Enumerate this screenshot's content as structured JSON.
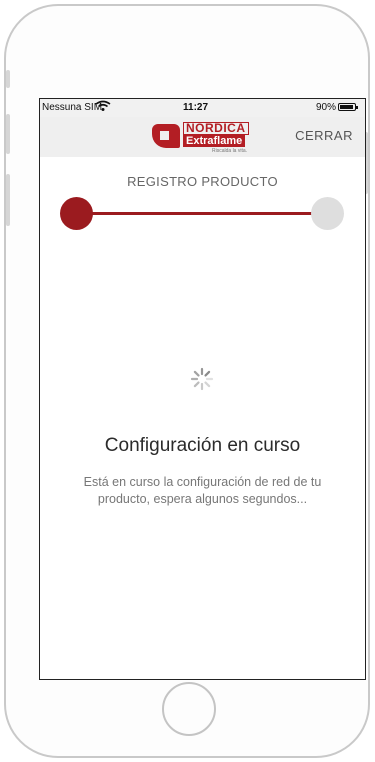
{
  "status_bar": {
    "carrier": "Nessuna SIM",
    "time": "11:27",
    "battery": "90%",
    "battery_level": 0.9
  },
  "header": {
    "logo": {
      "brand_line1": "NORDICA",
      "brand_line2": "Extraflame",
      "tagline": "Riscalda la vita."
    },
    "close_label": "CERRAR"
  },
  "registration": {
    "step_title": "REGISTRO PRODUCTO",
    "progress": 1.0
  },
  "status": {
    "headline": "Configuración en curso",
    "message": "Está en curso la configuración de red de tu producto, espera algunos segundos..."
  },
  "colors": {
    "brand_red": "#b31e24",
    "progress_red": "#9b1b1f",
    "inactive_gray": "#dedede"
  },
  "icons": {
    "wifi": "wifi-icon",
    "loading": "loading-spinner-icon",
    "battery": "battery-icon"
  }
}
